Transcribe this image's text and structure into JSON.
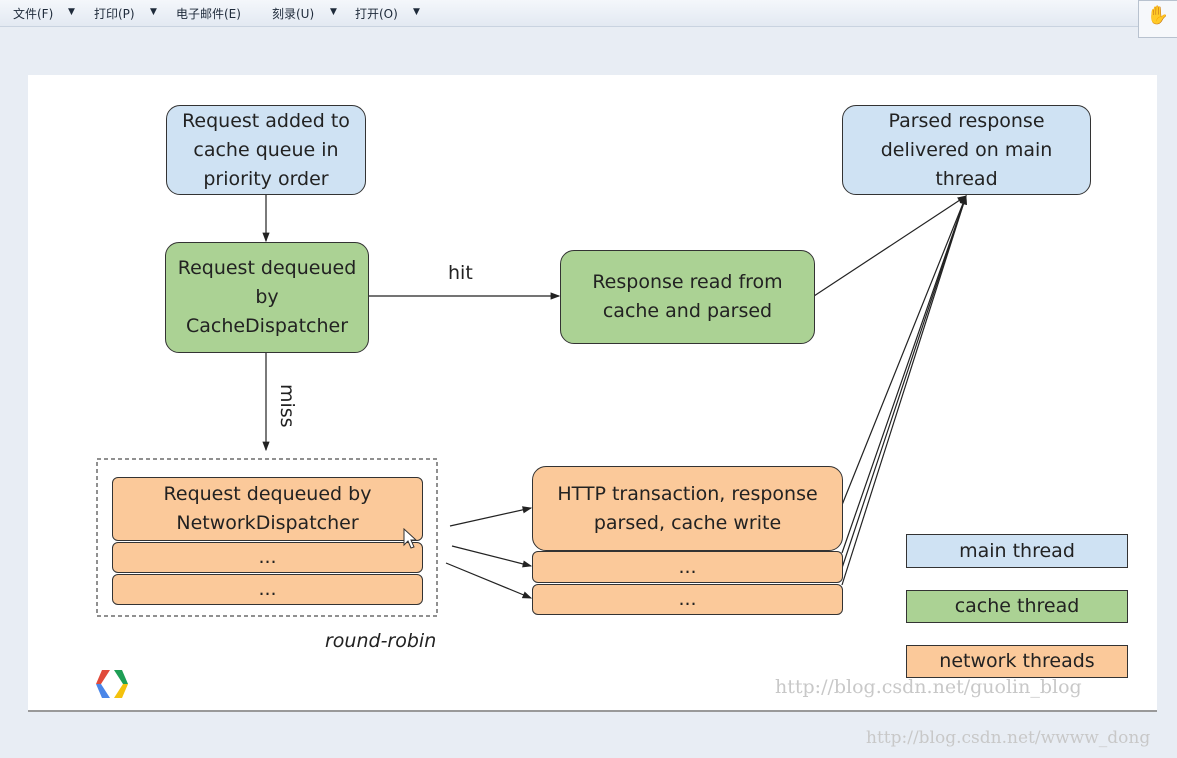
{
  "menu": [
    {
      "label": "文件(F)",
      "dropdown": true
    },
    {
      "label": "打印(P)",
      "dropdown": true
    },
    {
      "label": "电子邮件(E)",
      "dropdown": false
    },
    {
      "label": "刻录(U)",
      "dropdown": true
    },
    {
      "label": "打开(O)",
      "dropdown": true
    }
  ],
  "toolbar": {
    "hand_icon": "hand-tool-icon"
  },
  "diagram": {
    "nodes": {
      "queue": "Request added to cache queue in priority order",
      "cache_dispatcher": "Request dequeued by CacheDispatcher",
      "cache_read": "Response read from cache and parsed",
      "delivered": "Parsed response delivered on main thread",
      "network_dispatcher": "Request dequeued by NetworkDispatcher",
      "network_more1": "...",
      "network_more2": "...",
      "http": "HTTP transaction, response parsed, cache write",
      "http_more1": "...",
      "http_more2": "..."
    },
    "edges": {
      "hit": "hit",
      "miss": "miss",
      "round_robin": "round-robin"
    },
    "legend": [
      {
        "label": "main thread",
        "color": "#cfe2f3"
      },
      {
        "label": "cache thread",
        "color": "#abd294"
      },
      {
        "label": "network threads",
        "color": "#fbc99a"
      }
    ]
  },
  "watermarks": [
    "http://blog.csdn.net/guolin_blog",
    "http://blog.csdn.net/wwww_dong"
  ]
}
